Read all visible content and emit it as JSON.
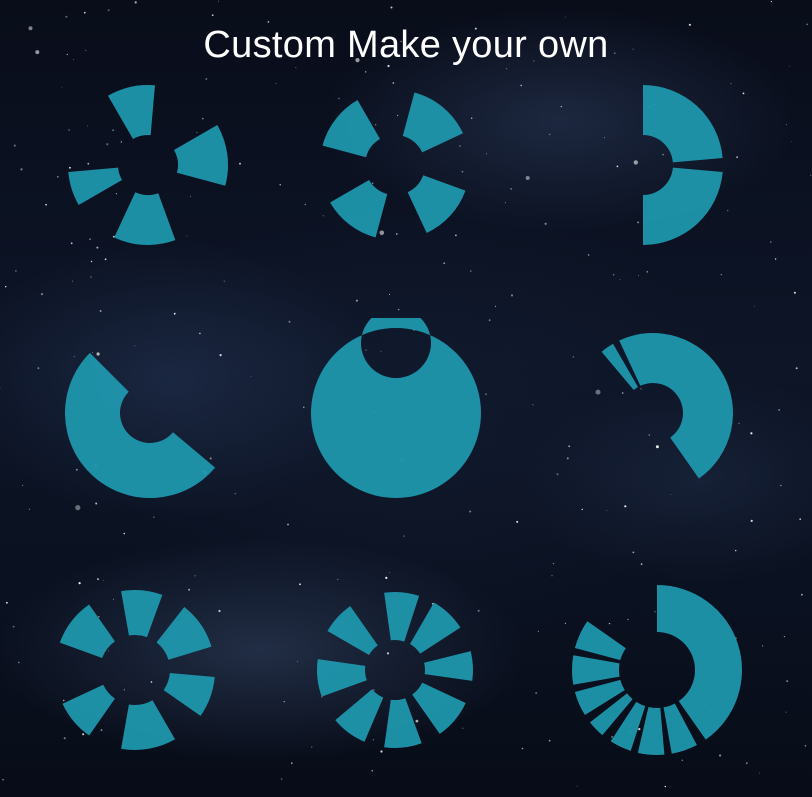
{
  "header": {
    "title": "Custom Make your own"
  },
  "theme": {
    "accent": "#1f97ad",
    "background": "#0a1020"
  },
  "tiles": [
    {
      "name": "wheel-pattern-1",
      "inner": 30,
      "outer": 80,
      "segments": [
        [
          -30,
          5
        ],
        [
          60,
          105
        ],
        [
          160,
          205
        ],
        [
          240,
          265
        ]
      ]
    },
    {
      "name": "wheel-pattern-2",
      "inner": 30,
      "outer": 75,
      "segments": [
        [
          15,
          65
        ],
        [
          110,
          155
        ],
        [
          195,
          240
        ],
        [
          285,
          330
        ]
      ]
    },
    {
      "name": "wheel-pattern-3",
      "inner": 30,
      "outer": 80,
      "segments": [
        [
          0,
          85
        ],
        [
          95,
          180
        ]
      ]
    },
    {
      "name": "wheel-pattern-4",
      "inner": 30,
      "outer": 85,
      "segments": [
        [
          130,
          315
        ]
      ]
    },
    {
      "name": "full-ring",
      "inner": 35,
      "outer": 85,
      "segments": [
        [
          0,
          360
        ]
      ]
    },
    {
      "name": "wheel-pattern-6",
      "inner": 30,
      "outer": 80,
      "segments": [
        [
          320,
          330
        ],
        [
          335,
          505
        ]
      ]
    },
    {
      "name": "wheel-pattern-7",
      "inner": 35,
      "outer": 80,
      "segments": [
        [
          -10,
          20
        ],
        [
          38,
          73
        ],
        [
          95,
          125
        ],
        [
          150,
          190
        ],
        [
          215,
          245
        ],
        [
          290,
          325
        ]
      ]
    },
    {
      "name": "wheel-pattern-8",
      "inner": 30,
      "outer": 78,
      "segments": [
        [
          -8,
          18
        ],
        [
          30,
          57
        ],
        [
          76,
          98
        ],
        [
          115,
          145
        ],
        [
          160,
          188
        ],
        [
          203,
          230
        ],
        [
          250,
          278
        ],
        [
          300,
          325
        ]
      ]
    },
    {
      "name": "wheel-pattern-9",
      "inner": 38,
      "outer": 85,
      "segments": [
        [
          0,
          145
        ],
        [
          152,
          170
        ],
        [
          175,
          193
        ],
        [
          198,
          213
        ],
        [
          220,
          232
        ],
        [
          238,
          255
        ],
        [
          260,
          280
        ],
        [
          285,
          305
        ]
      ]
    }
  ]
}
